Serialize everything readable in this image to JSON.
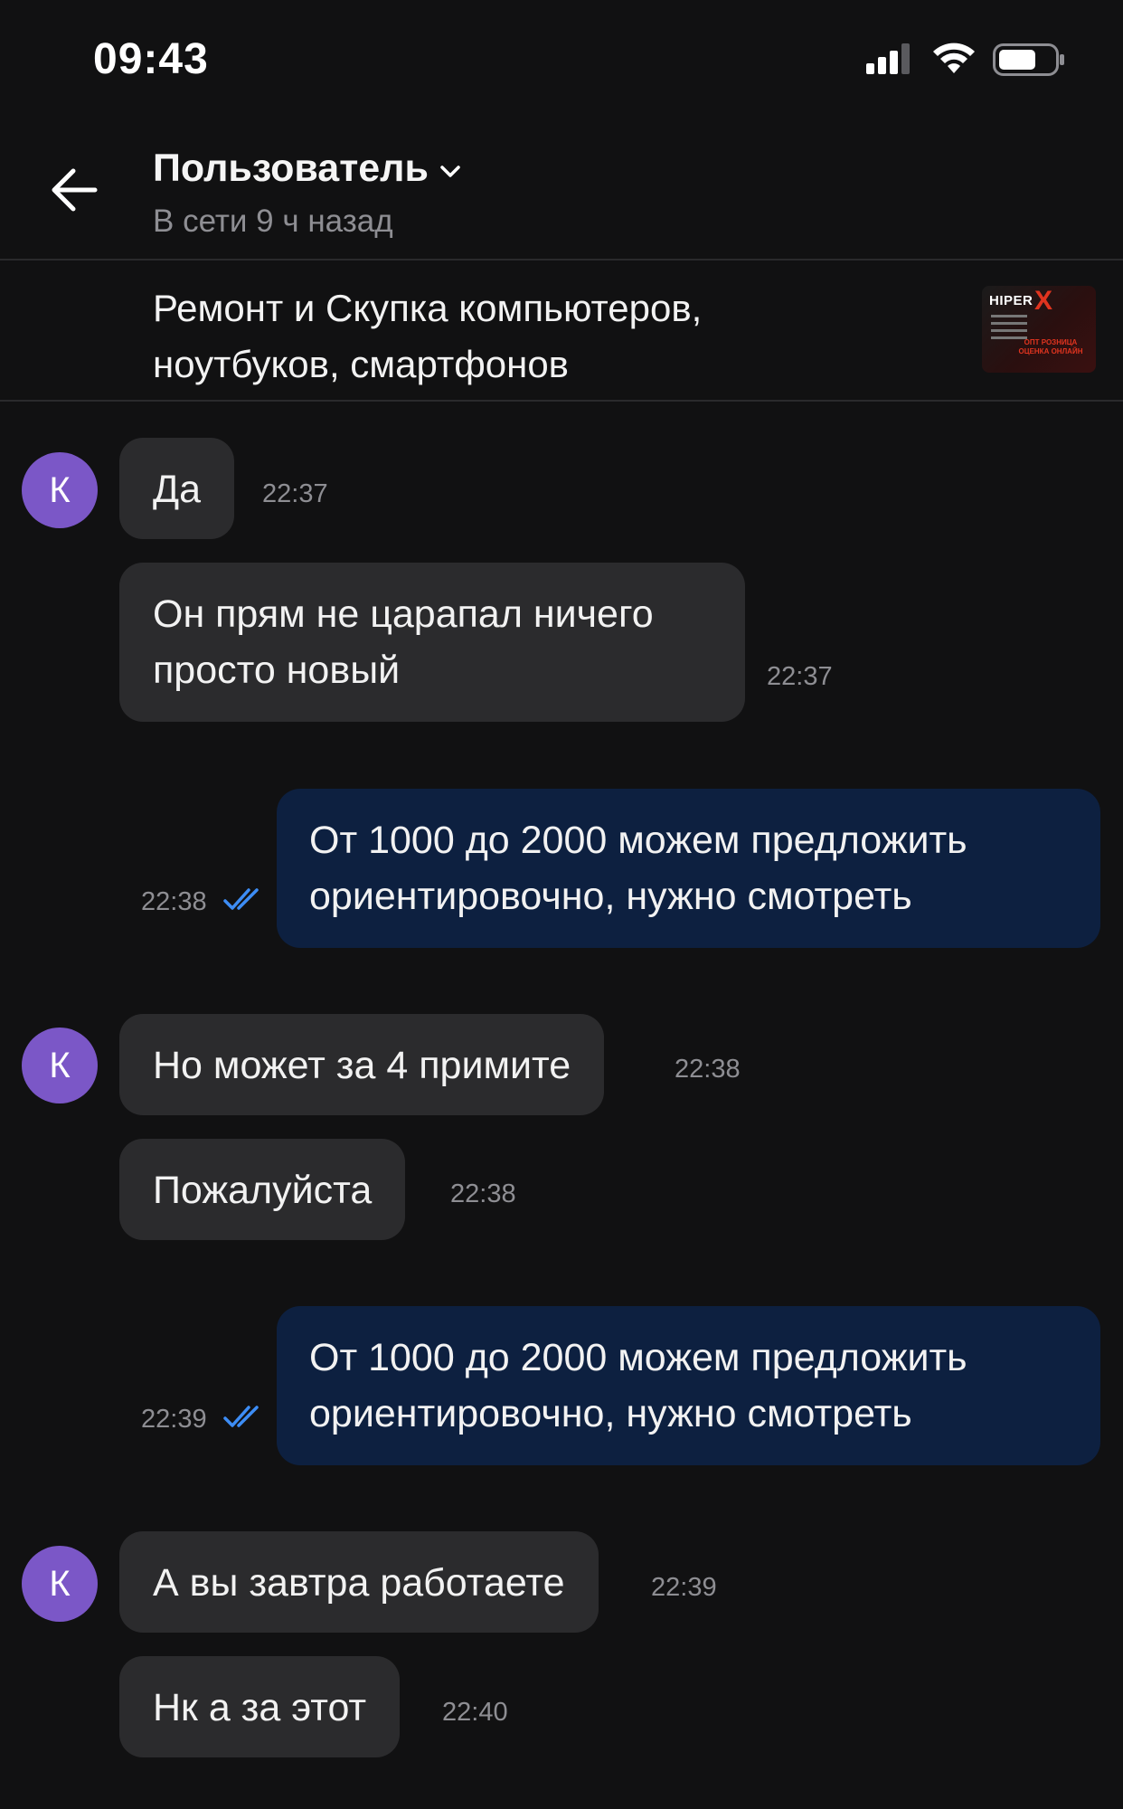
{
  "status_bar": {
    "time": "09:43",
    "icons": [
      "signal-icon",
      "wifi-icon",
      "battery-icon"
    ]
  },
  "header": {
    "back_icon": "arrow-left-icon",
    "contact_name": "Пользователь",
    "status": "В сети 9 ч назад"
  },
  "listing": {
    "title": "Ремонт и Скупка компьютеров, ноутбуков, смартфонов",
    "thumbnail_brand": "HIPER",
    "thumbnail_mark": "X",
    "thumbnail_caption": "ОПТ РОЗНИЦА ОЦЕНКА ОНЛАЙН"
  },
  "colors": {
    "background": "#111112",
    "incoming_bubble": "#2b2b2d",
    "outgoing_bubble": "#0d2040",
    "avatar": "#7b57c7",
    "read_check": "#3d8df5",
    "muted_text": "#8e8e93"
  },
  "messages": [
    {
      "direction": "in",
      "avatar": "К",
      "text": "Да",
      "time": "22:37"
    },
    {
      "direction": "in",
      "text": "Он прям не царапал ничего просто новый",
      "time": "22:37"
    },
    {
      "direction": "out",
      "text": "От 1000 до 2000 можем предложить ориентировочно, нужно смотреть",
      "time": "22:38",
      "read": true
    },
    {
      "direction": "in",
      "avatar": "К",
      "text": "Но может за 4 примите",
      "time": "22:38"
    },
    {
      "direction": "in",
      "text": "Пожалуйста",
      "time": "22:38"
    },
    {
      "direction": "out",
      "text": "От 1000 до 2000 можем предложить ориентировочно, нужно смотреть",
      "time": "22:39",
      "read": true
    },
    {
      "direction": "in",
      "avatar": "К",
      "text": "А вы завтра работаете",
      "time": "22:39"
    },
    {
      "direction": "in",
      "text": "Нк а за этот",
      "time": "22:40"
    }
  ]
}
